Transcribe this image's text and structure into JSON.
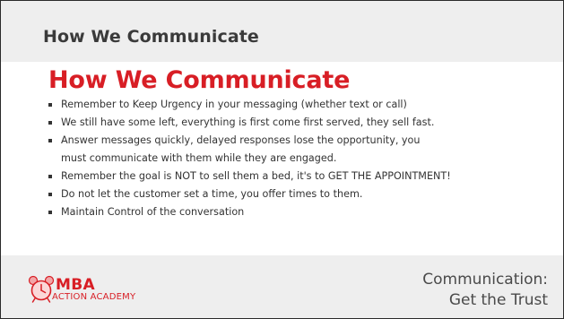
{
  "header": {
    "title": "How We Communicate"
  },
  "main": {
    "title": "How We Communicate",
    "bullets": [
      "Remember to Keep Urgency in your messaging (whether text or call)",
      "We still have some left, everything is first come first served, they sell fast.",
      "Answer messages quickly, delayed responses lose the opportunity, you",
      "must communicate with them while they are engaged.",
      "Remember the goal is NOT to sell them a bed, it's to GET THE APPOINTMENT!",
      "Do not let the customer set a time, you offer times to them.",
      "Maintain Control of the conversation"
    ]
  },
  "footer": {
    "logo": {
      "name": "MBA",
      "subtitle": "ACTION ACADEMY",
      "icon": "alarm-clock-icon"
    },
    "caption_line1": "Communication:",
    "caption_line2": "Get the Trust"
  },
  "colors": {
    "accent": "#d81e25",
    "band": "#eeeeee",
    "text": "#333333"
  }
}
